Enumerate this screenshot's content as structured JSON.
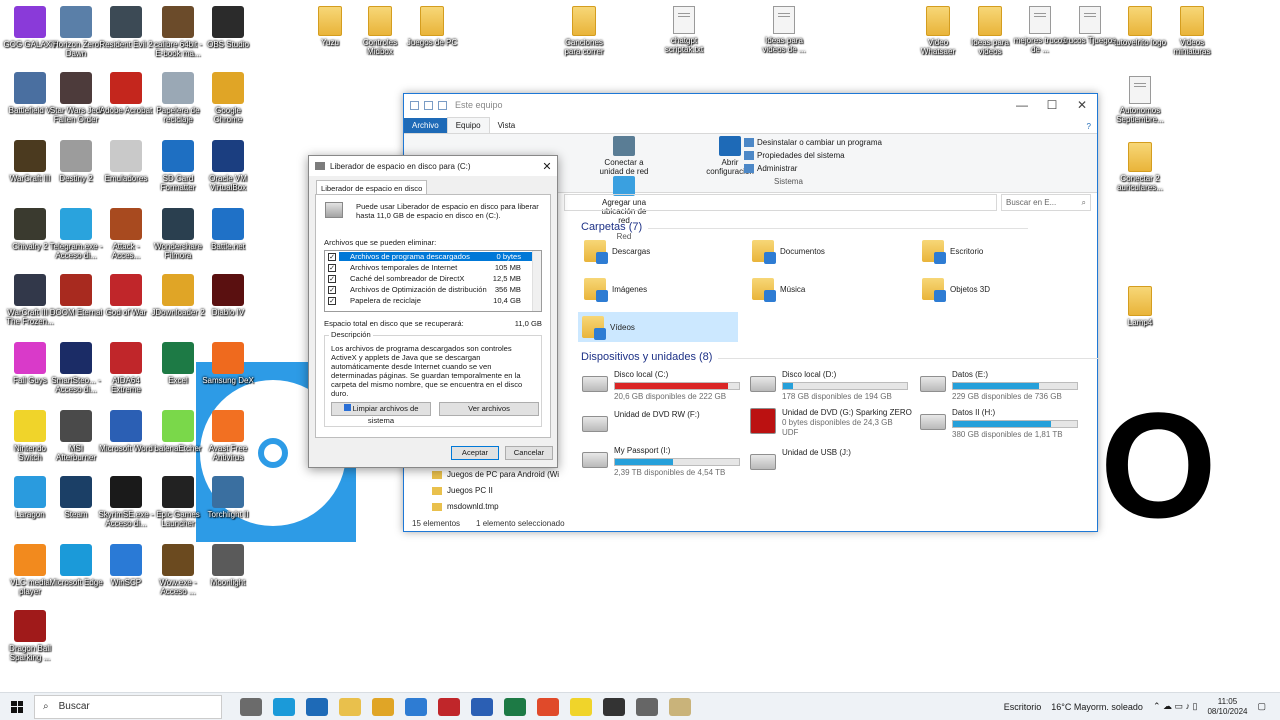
{
  "desktop": {
    "icons": [
      {
        "label": "GOG GALAXY",
        "color": "#8a3ad9"
      },
      {
        "label": "Horizon Zero Dawn",
        "color": "#5a7fa8"
      },
      {
        "label": "Resident Evil 2",
        "color": "#3c4a55"
      },
      {
        "label": "calibre 64bit - E-book ma...",
        "color": "#6b4b2a"
      },
      {
        "label": "OBS Studio",
        "color": "#2b2b2b"
      },
      {
        "label": "Battlefield V",
        "color": "#4a6fa0"
      },
      {
        "label": "Star Wars Jedi Fallen Order",
        "color": "#4d3b3b"
      },
      {
        "label": "Adobe Acrobat",
        "color": "#c4261d"
      },
      {
        "label": "Papelera de reciclaje",
        "color": "#9aa8b5"
      },
      {
        "label": "Google Chrome",
        "color": "#e0a526"
      },
      {
        "label": "WarCraft III",
        "color": "#4b3a1f"
      },
      {
        "label": "Destiny 2",
        "color": "#9c9c9c"
      },
      {
        "label": "Emuladores",
        "color": "#c9c9c9"
      },
      {
        "label": "SD Card Formatter",
        "color": "#1e6fc2"
      },
      {
        "label": "Oracle VM VirtualBox",
        "color": "#1b3e80"
      },
      {
        "label": "Chivalry 2",
        "color": "#3a3a2f"
      },
      {
        "label": "Telegram.exe - Acceso di...",
        "color": "#2aa3dd"
      },
      {
        "label": "Attack - Acces...",
        "color": "#a84a1f"
      },
      {
        "label": "Wondershare Filmora",
        "color": "#2a3f4f"
      },
      {
        "label": "Battle.net",
        "color": "#1f71c7"
      },
      {
        "label": "WarCraft III - The Frozen...",
        "color": "#32384a"
      },
      {
        "label": "DOOM Eternal",
        "color": "#a82a1f"
      },
      {
        "label": "God of War",
        "color": "#c0262a"
      },
      {
        "label": "JDownloader 2",
        "color": "#e0a526"
      },
      {
        "label": "Diablo IV",
        "color": "#5a1010"
      },
      {
        "label": "Fall Guys",
        "color": "#d93ac9"
      },
      {
        "label": "SmartSteo... - Acceso di...",
        "color": "#1b2c66"
      },
      {
        "label": "AIDA64 Extreme",
        "color": "#c0262a"
      },
      {
        "label": "Excel",
        "color": "#1d7a45"
      },
      {
        "label": "Samsung DeX",
        "color": "#ef6a1e"
      },
      {
        "label": "Nintendo Switch",
        "color": "#f0d42a"
      },
      {
        "label": "MSI Afterburner",
        "color": "#4a4a4a"
      },
      {
        "label": "Microsoft Word",
        "color": "#2b5fb4"
      },
      {
        "label": "balenaEtcher",
        "color": "#7ad84a"
      },
      {
        "label": "Avast Free Antivirus",
        "color": "#f27022"
      },
      {
        "label": "Laragon",
        "color": "#2a9bde"
      },
      {
        "label": "Steam",
        "color": "#1b3f66"
      },
      {
        "label": "SkyrimSE.exe - Acceso di...",
        "color": "#1a1a1a"
      },
      {
        "label": "Epic Games Launcher",
        "color": "#222222"
      },
      {
        "label": "Torchlight II",
        "color": "#3a6fa0"
      },
      {
        "label": "VLC media player",
        "color": "#f28a1e"
      },
      {
        "label": "Microsoft Edge",
        "color": "#1b9ad9"
      },
      {
        "label": "WinSCP",
        "color": "#2a7ad6"
      },
      {
        "label": "Wow.exe - Acceso ...",
        "color": "#6b4a1f"
      },
      {
        "label": "Moonlight",
        "color": "#5a5a5a"
      },
      {
        "label": "Dragon Ball Sparking ...",
        "color": "#a01a1a"
      }
    ],
    "top_files": [
      {
        "label": "Yuzu",
        "type": "folder"
      },
      {
        "label": "Controles Midbox",
        "type": "folder"
      },
      {
        "label": "Juegos de PC",
        "type": "folder"
      },
      {
        "label": "Canciones para correr",
        "type": "folder"
      },
      {
        "label": "chatgpt scriptak.txt",
        "type": "doc"
      },
      {
        "label": "Ideas para videos de ...",
        "type": "doc"
      },
      {
        "label": "Video Whatsaer",
        "type": "folder"
      },
      {
        "label": "Ideas para videos",
        "type": "folder"
      },
      {
        "label": "mejores trucos de ...",
        "type": "doc"
      },
      {
        "label": "trucos Tjuegos",
        "type": "doc"
      },
      {
        "label": "tutovelrito logo",
        "type": "folder"
      },
      {
        "label": "Videos miniaturas",
        "type": "folder"
      }
    ],
    "right_items": [
      {
        "label": "Autonomos Septiembre..."
      },
      {
        "label": "Conectar 2 auriculares..."
      },
      {
        "label": "Lamp4"
      }
    ],
    "big_letter": "O"
  },
  "explorer": {
    "title": "Este equipo",
    "tabs": [
      "Archivo",
      "Equipo",
      "Vista"
    ],
    "ribbon": {
      "connect_drive": "Conectar a unidad de red",
      "add_location": "Agregar una ubicación de red",
      "open_config": "Abrir configuración",
      "uninstall": "Desinstalar o cambiar un programa",
      "system_props": "Propiedades del sistema",
      "manage": "Administrar",
      "group_network": "Red",
      "group_system": "Sistema"
    },
    "search_placeholder": "Buscar en E...",
    "folders_title": "Carpetas (7)",
    "folders": [
      "Descargas",
      "Documentos",
      "Escritorio",
      "Imágenes",
      "Música",
      "Objetos 3D",
      "Vídeos"
    ],
    "devices_title": "Dispositivos y unidades (8)",
    "drives": [
      {
        "name": "Disco local (C:)",
        "info": "20,6 GB disponibles de 222 GB",
        "used": 0.91
      },
      {
        "name": "Disco local (D:)",
        "info": "178 GB disponibles de 194 GB",
        "used": 0.08
      },
      {
        "name": "Datos (E:)",
        "info": "229 GB disponibles de 736 GB",
        "used": 0.69
      },
      {
        "name": "Unidad de DVD RW (F:)",
        "info": ""
      },
      {
        "name": "Unidad de DVD (G:) Sparking ZERO",
        "info": "0 bytes disponibles de 24,3 GB",
        "extra": "UDF"
      },
      {
        "name": "Datos II (H:)",
        "info": "380 GB disponibles de 1,81 TB",
        "used": 0.79
      },
      {
        "name": "My Passport (I:)",
        "info": "2,39 TB disponibles de 4,54 TB",
        "used": 0.47
      },
      {
        "name": "Unidad de USB (J:)",
        "info": ""
      }
    ],
    "nav": [
      "Juegos de PC para Android (Wi",
      "Juegos PC II",
      "msdownld.tmp"
    ],
    "status_items": "15 elementos",
    "status_selected": "1 elemento seleccionado"
  },
  "cleanup": {
    "title": "Liberador de espacio en disco para  (C:)",
    "tab": "Liberador de espacio en disco",
    "intro": "Puede usar Liberador de espacio en disco para liberar hasta 11,0 GB de espacio en disco en  (C:).",
    "files_label": "Archivos que se pueden eliminar:",
    "items": [
      {
        "name": "Archivos de programa descargados",
        "size": "0 bytes",
        "checked": true
      },
      {
        "name": "Archivos temporales de Internet",
        "size": "105 MB",
        "checked": true
      },
      {
        "name": "Caché del sombreador de DirectX",
        "size": "12,5 MB",
        "checked": true
      },
      {
        "name": "Archivos de Optimización de distribución",
        "size": "356 MB",
        "checked": true
      },
      {
        "name": "Papelera de reciclaje",
        "size": "10,4 GB",
        "checked": true
      }
    ],
    "total_label": "Espacio total en disco que se recuperará:",
    "total_value": "11,0 GB",
    "desc_label": "Descripción",
    "desc_text": "Los archivos de programa descargados son controles ActiveX y applets de Java que se descargan automáticamente desde Internet cuando se ven determinadas páginas. Se guardan temporalmente en la carpeta del mismo nombre, que se encuentra en el disco duro.",
    "clean_system": "Limpiar archivos de sistema",
    "view_files": "Ver archivos",
    "accept": "Aceptar",
    "cancel": "Cancelar"
  },
  "taskbar": {
    "search": "Buscar",
    "desktop_label": "Escritorio",
    "weather": "16°C  Mayorm. soleado",
    "time": "11:05",
    "date": "08/10/2024"
  }
}
